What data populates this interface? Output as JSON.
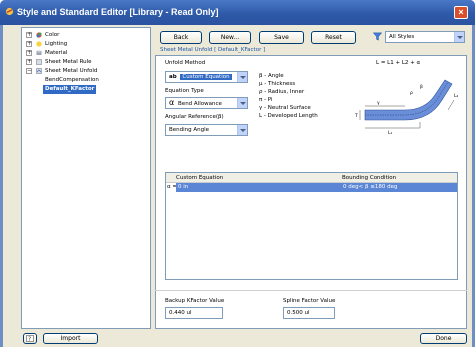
{
  "window": {
    "title": "Style and Standard Editor [Library - Read Only]"
  },
  "tree": {
    "items": [
      {
        "label": "Color",
        "expander": "+",
        "icon": "color-icon"
      },
      {
        "label": "Lighting",
        "expander": "+",
        "icon": "lighting-icon"
      },
      {
        "label": "Material",
        "expander": "+",
        "icon": "material-icon"
      },
      {
        "label": "Sheet Metal Rule",
        "expander": "+",
        "icon": "sheet-metal-rule-icon"
      },
      {
        "label": "Sheet Metal Unfold",
        "expander": "−",
        "icon": "sheet-metal-unfold-icon"
      },
      {
        "label": "BendCompensation"
      },
      {
        "label": "Default_KFactor",
        "selected": true
      }
    ]
  },
  "toolbar": {
    "back": "Back",
    "new": "New...",
    "save": "Save",
    "reset": "Reset",
    "filter": "All Styles"
  },
  "header": {
    "link": "Sheet Metal Unfold [ Default_KFactor ]"
  },
  "unfold": {
    "method_label": "Unfold Method",
    "method_value": "Custom Equation",
    "method_icon": "ab",
    "equation_type_label": "Equation Type",
    "equation_type_value": "Bend Allowance",
    "equation_type_icon": "α",
    "angular_ref_label": "Angular Reference(β)",
    "angular_ref_value": "Bending Angle"
  },
  "legend": [
    "β - Angle",
    "μ - Thickness",
    "ρ - Radius, Inner",
    "π - Pi",
    "γ - Neutral Surface",
    "L - Developed Length"
  ],
  "diagram": {
    "formula": "L = L1 + L2 + α",
    "labels": {
      "beta": "β",
      "rho": "ρ",
      "gamma": "γ",
      "mu": "μ",
      "l1": "L₁",
      "l2": "L₂",
      "t": "T"
    }
  },
  "grid": {
    "headers": [
      "Custom Equation",
      "Bounding Condition"
    ],
    "rows": [
      {
        "marker": "α =",
        "equation": "0 in",
        "condition": "0 deg< β ≤180 deg"
      }
    ]
  },
  "fields": {
    "backup_kfactor_label": "Backup KFactor Value",
    "backup_kfactor_value": "0.440 ul",
    "spline_factor_label": "Spline Factor Value",
    "spline_factor_value": "0.500 ul"
  },
  "footer": {
    "import": "Import",
    "done": "Done"
  },
  "colors": {
    "titlebar": "#2e5aa8",
    "accent_link": "#1f56a8",
    "selection": "#316ac5",
    "diagram_blue": "#6a8fd8"
  }
}
